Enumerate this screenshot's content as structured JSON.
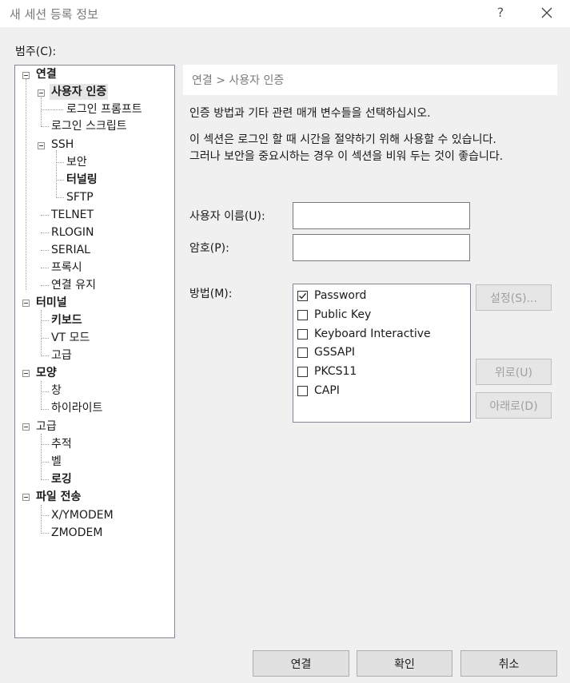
{
  "window": {
    "title": "새 세션 등록 정보",
    "help": "?"
  },
  "category_label": "범주(C):",
  "tree": [
    {
      "label": "연결",
      "bold": true
    },
    {
      "label": "사용자 인증",
      "bold": true,
      "selected": true
    },
    {
      "label": "로그인 프롬프트"
    },
    {
      "label": "로그인 스크립트"
    },
    {
      "label": "SSH"
    },
    {
      "label": "보안"
    },
    {
      "label": "터널링",
      "bold": true
    },
    {
      "label": "SFTP"
    },
    {
      "label": "TELNET"
    },
    {
      "label": "RLOGIN"
    },
    {
      "label": "SERIAL"
    },
    {
      "label": "프록시"
    },
    {
      "label": "연결 유지"
    },
    {
      "label": "터미널",
      "bold": true
    },
    {
      "label": "키보드",
      "bold": true
    },
    {
      "label": "VT 모드"
    },
    {
      "label": "고급"
    },
    {
      "label": "모양",
      "bold": true
    },
    {
      "label": "창"
    },
    {
      "label": "하이라이트"
    },
    {
      "label": "고급"
    },
    {
      "label": "추적"
    },
    {
      "label": "벨"
    },
    {
      "label": "로깅",
      "bold": true
    },
    {
      "label": "파일 전송",
      "bold": true
    },
    {
      "label": "X/YMODEM"
    },
    {
      "label": "ZMODEM"
    }
  ],
  "breadcrumb": "연결 > 사용자 인증",
  "description": {
    "line1": "인증 방법과 기타 관련 매개 변수들을 선택하십시오.",
    "line2": "이 섹션은 로그인 할 때 시간을 절약하기 위해 사용할 수 있습니다.",
    "line3": "그러나 보안을 중요시하는 경우 이 섹션을 비워 두는 것이 좋습니다."
  },
  "form": {
    "username_label": "사용자 이름(U):",
    "username_value": "",
    "password_label": "암호(P):",
    "password_value": "",
    "method_label": "방법(M):"
  },
  "methods": [
    {
      "label": "Password",
      "checked": true
    },
    {
      "label": "Public Key",
      "checked": false
    },
    {
      "label": "Keyboard Interactive",
      "checked": false
    },
    {
      "label": "GSSAPI",
      "checked": false
    },
    {
      "label": "PKCS11",
      "checked": false
    },
    {
      "label": "CAPI",
      "checked": false
    }
  ],
  "method_buttons": {
    "settings": "설정(S)...",
    "up": "위로(U)",
    "down": "아래로(D)"
  },
  "footer": {
    "connect": "연결",
    "ok": "확인",
    "cancel": "취소"
  },
  "colors": {
    "window_bg": "#f0f0f0",
    "button_bg": "#e1e1e1",
    "disabled_text": "#a0a0a0"
  }
}
